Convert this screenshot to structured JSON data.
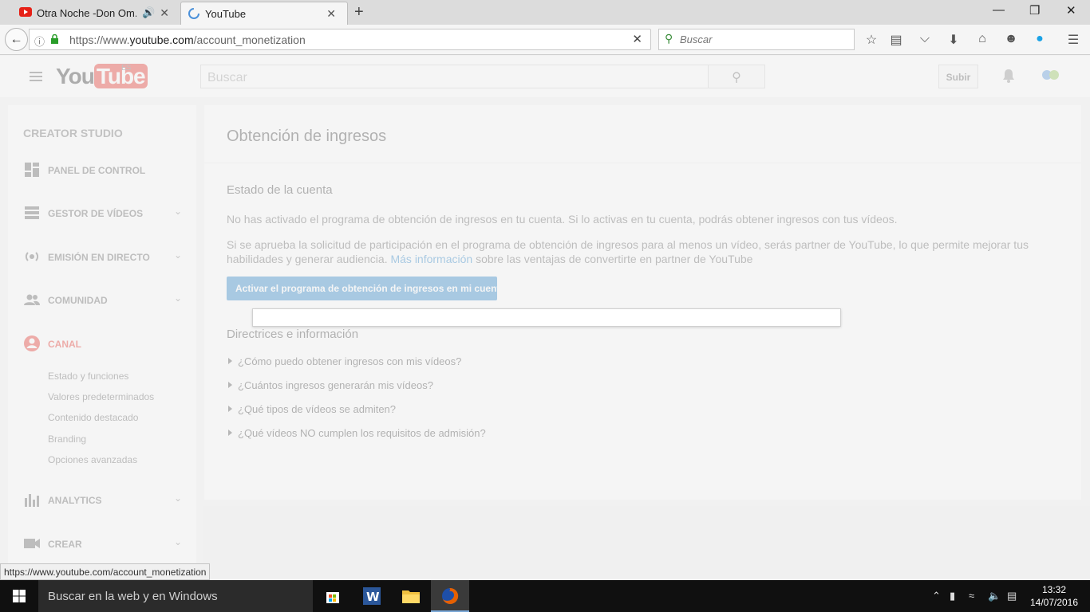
{
  "browser": {
    "tabs": [
      {
        "title": "Otra Noche -Don Om...",
        "favicon": "youtube-icon",
        "audio": "speaker-icon"
      },
      {
        "title": "YouTube",
        "favicon": "loading-icon"
      }
    ],
    "url_prefix": "https://www.",
    "url_domain": "youtube.com",
    "url_path": "/account_monetization",
    "search_placeholder": "Buscar",
    "status_url": "https://www.youtube.com/account_monetization"
  },
  "youtube": {
    "logo_you": "You",
    "logo_tube": "Tube",
    "logo_locale": "ES",
    "search_placeholder": "Buscar",
    "upload_label": "Subir",
    "colors": {
      "brand_red": "#e62117",
      "link_blue": "#167ac6"
    }
  },
  "sidebar": {
    "title": "CREATOR STUDIO",
    "items": [
      {
        "label": "PANEL DE CONTROL",
        "icon": "dashboard-icon"
      },
      {
        "label": "GESTOR DE VÍDEOS",
        "icon": "video-manager-icon"
      },
      {
        "label": "EMISIÓN EN DIRECTO",
        "icon": "live-icon"
      },
      {
        "label": "COMUNIDAD",
        "icon": "community-icon"
      },
      {
        "label": "CANAL",
        "icon": "channel-icon"
      },
      {
        "label": "ANALYTICS",
        "icon": "analytics-icon"
      },
      {
        "label": "CREAR",
        "icon": "camera-icon"
      }
    ],
    "subitems": [
      "Estado y funciones",
      "Valores predeterminados",
      "Contenido destacado",
      "Branding",
      "Opciones avanzadas"
    ]
  },
  "main": {
    "title": "Obtención de ingresos",
    "account_status_heading": "Estado de la cuenta",
    "para1": "No has activado el programa de obtención de ingresos en tu cuenta. Si lo activas en tu cuenta, podrás obtener ingresos con tus vídeos.",
    "para2_a": "Si se aprueba la solicitud de participación en el programa de obtención de ingresos para al menos un vídeo, serás partner de YouTube, lo que permite mejorar tus habilidades y generar audiencia. ",
    "para2_link": "Más información",
    "para2_b": " sobre las ventajas de convertirte en partner de YouTube",
    "activate_button": "Activar el programa de obtención de ingresos en mi cuenta",
    "guidelines_heading": "Directrices e información",
    "faq": [
      "¿Cómo puedo obtener ingresos con mis vídeos?",
      "¿Cuántos ingresos generarán mis vídeos?",
      "¿Qué tipos de vídeos se admiten?",
      "¿Qué vídeos NO cumplen los requisitos de admisión?"
    ]
  },
  "taskbar": {
    "search_placeholder": "Buscar en la web y en Windows",
    "time": "13:32",
    "date": "14/07/2016"
  }
}
